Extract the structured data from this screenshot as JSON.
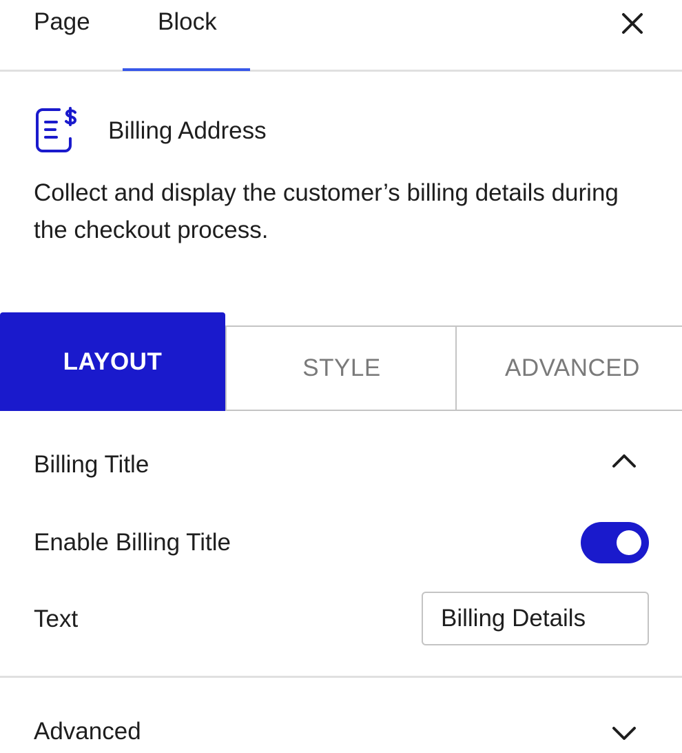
{
  "tabs": [
    {
      "label": "Page"
    },
    {
      "label": "Block"
    }
  ],
  "active_tab": "Block",
  "block": {
    "icon": "billing-document-dollar-icon",
    "title": "Billing Address",
    "description": "Collect and display the customer’s billing details during the checkout process."
  },
  "segments": [
    {
      "label": "LAYOUT"
    },
    {
      "label": "STYLE"
    },
    {
      "label": "ADVANCED"
    }
  ],
  "active_segment": "LAYOUT",
  "billing_panel": {
    "title": "Billing Title",
    "expanded": true,
    "enable_label": "Enable Billing Title",
    "enable_value": true,
    "text_label": "Text",
    "text_value": "Billing Details"
  },
  "advanced_panel": {
    "title": "Advanced",
    "expanded": false
  },
  "colors": {
    "accent": "#1a1acc",
    "tab_underline": "#3858e9",
    "icon": "#1a1acc",
    "text": "#1e1e1e",
    "muted": "#7a7a7a",
    "border": "#c4c4c4"
  }
}
